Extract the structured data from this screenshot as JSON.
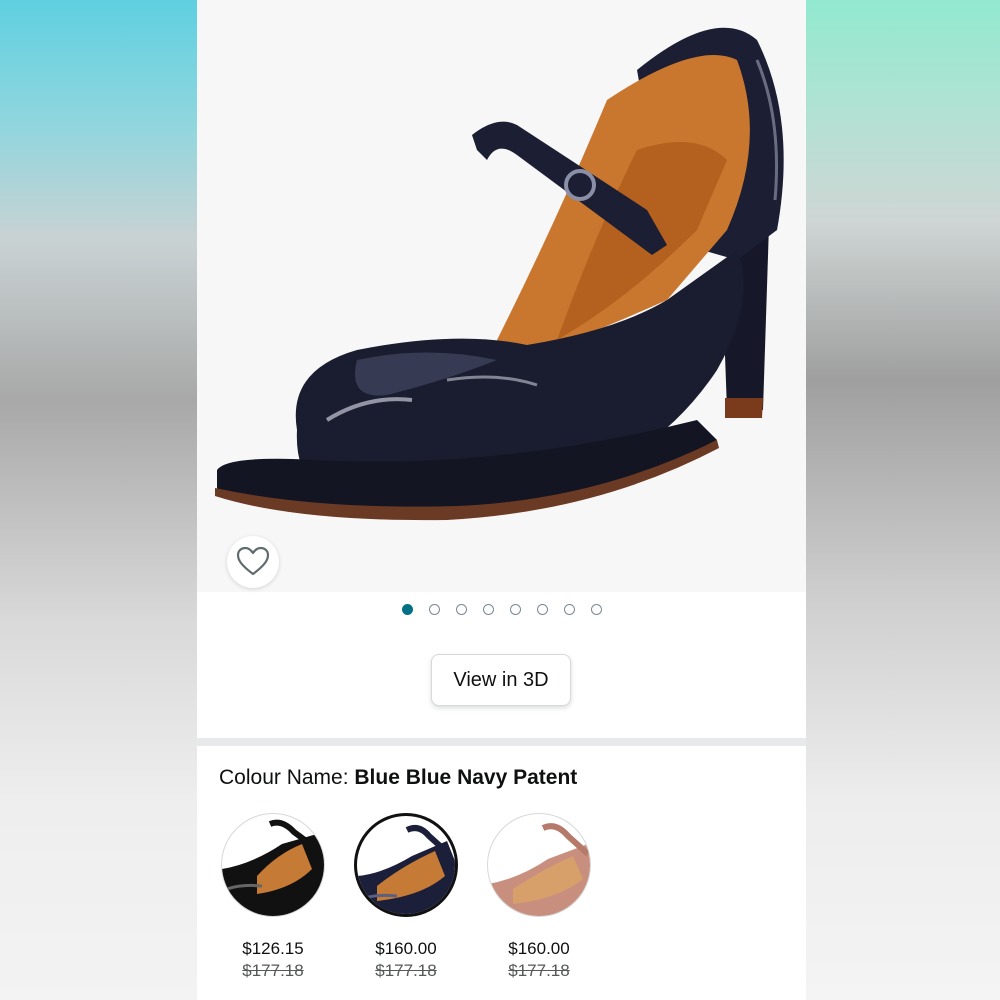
{
  "product": {
    "image_alt": "Blue patent leather Mary Jane platform heel",
    "image_count": 8,
    "active_image_index": 0
  },
  "actions": {
    "view_3d_label": "View in 3D",
    "wishlist_icon": "heart-icon"
  },
  "colour": {
    "label": "Colour Name: ",
    "selected_name": "Blue Blue Navy Patent",
    "options": [
      {
        "price": "$126.15",
        "was_price": "$177.18",
        "color": "#111111"
      },
      {
        "price": "$160.00",
        "was_price": "$177.18",
        "color": "#1c1f3a"
      },
      {
        "price": "$160.00",
        "was_price": "$177.18",
        "color": "#c98f7e"
      }
    ],
    "selected_index": 1
  },
  "colors": {
    "accent": "#007185",
    "patent_navy": "#1a1c30",
    "lining_tan": "#c9772e"
  }
}
